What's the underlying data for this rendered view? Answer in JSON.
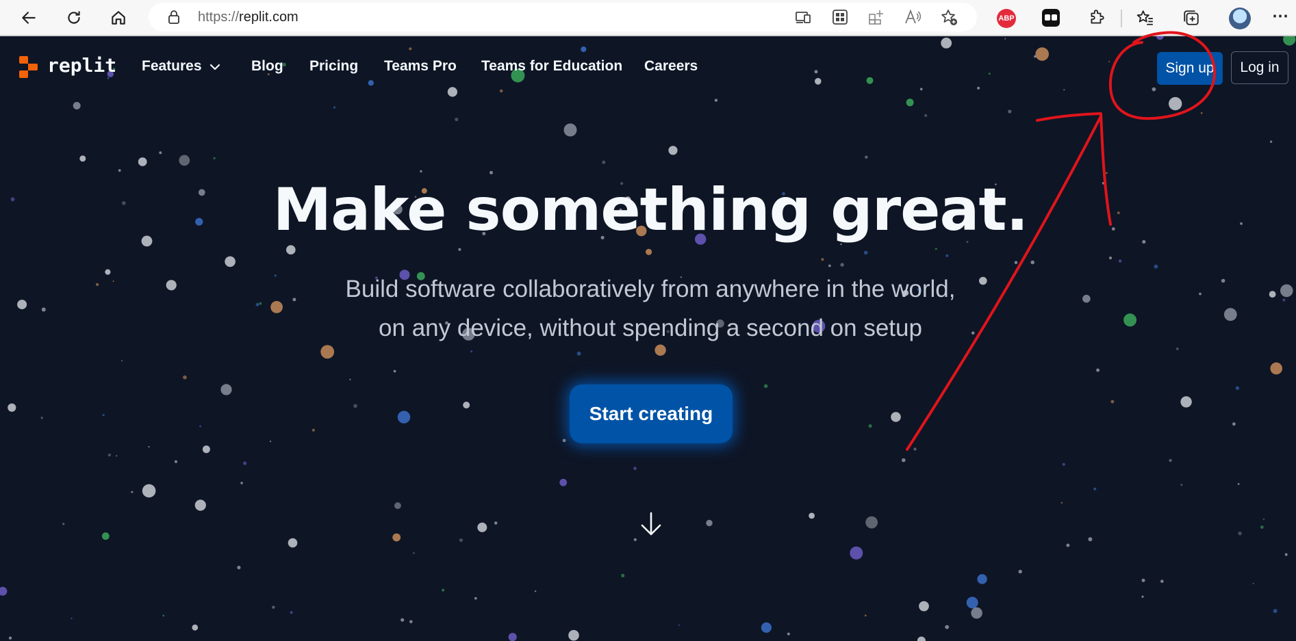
{
  "browser": {
    "url_scheme": "https://",
    "url_host": "replit.com",
    "abp_label": "ABP"
  },
  "nav": {
    "brand": "replit",
    "links": [
      "Features",
      "Blog",
      "Pricing",
      "Teams Pro",
      "Teams for Education",
      "Careers"
    ],
    "signup_label": "Sign up",
    "login_label": "Log in"
  },
  "hero": {
    "title": "Make something great.",
    "subtitle_line1": "Build software collaboratively from anywhere in the world,",
    "subtitle_line2": "on any device, without spending a second on setup",
    "cta_label": "Start creating"
  },
  "colors": {
    "page_bg": "#0e1525",
    "primary_button": "#0053a6",
    "logo_orange": "#f26207",
    "annotation_red": "#e0141b"
  },
  "icons": [
    "back-icon",
    "refresh-icon",
    "home-icon",
    "lock-icon",
    "app-available-icon",
    "qr-icon",
    "split-screen-icon",
    "read-aloud-icon",
    "add-favorite-icon",
    "adblock-icon",
    "extension-icon",
    "puzzle-icon",
    "favorites-icon",
    "collections-icon",
    "profile-avatar",
    "more-icon",
    "chevron-down-icon",
    "arrow-down-icon"
  ]
}
